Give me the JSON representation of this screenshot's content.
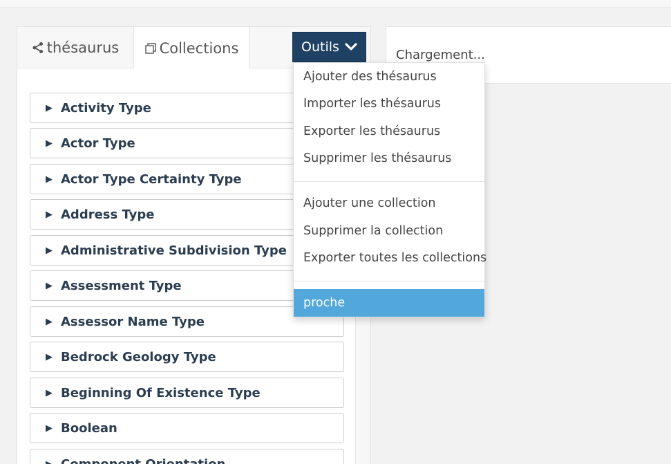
{
  "tabs": {
    "thesaurus_label": "thésaurus",
    "collections_label": "Collections"
  },
  "tools": {
    "button_label": "Outils"
  },
  "right_panel": {
    "loading_text": "Chargement..."
  },
  "dropdown": {
    "items": [
      "Ajouter des thésaurus",
      "Importer les thésaurus",
      "Exporter les thésaurus",
      "Supprimer les thésaurus",
      "Ajouter une collection",
      "Supprimer la collection",
      "Exporter toutes les collections",
      "proche"
    ]
  },
  "list": {
    "items": [
      "Activity Type",
      "Actor Type",
      "Actor Type Certainty Type",
      "Address Type",
      "Administrative Subdivision Type",
      "Assessment Type",
      "Assessor Name Type",
      "Bedrock Geology Type",
      "Beginning Of Existence Type",
      "Boolean",
      "Component Orientation"
    ]
  },
  "colors": {
    "tools_button": "#1f4164",
    "active_menu_item": "#52a8da",
    "item_text": "#2b3d50"
  }
}
